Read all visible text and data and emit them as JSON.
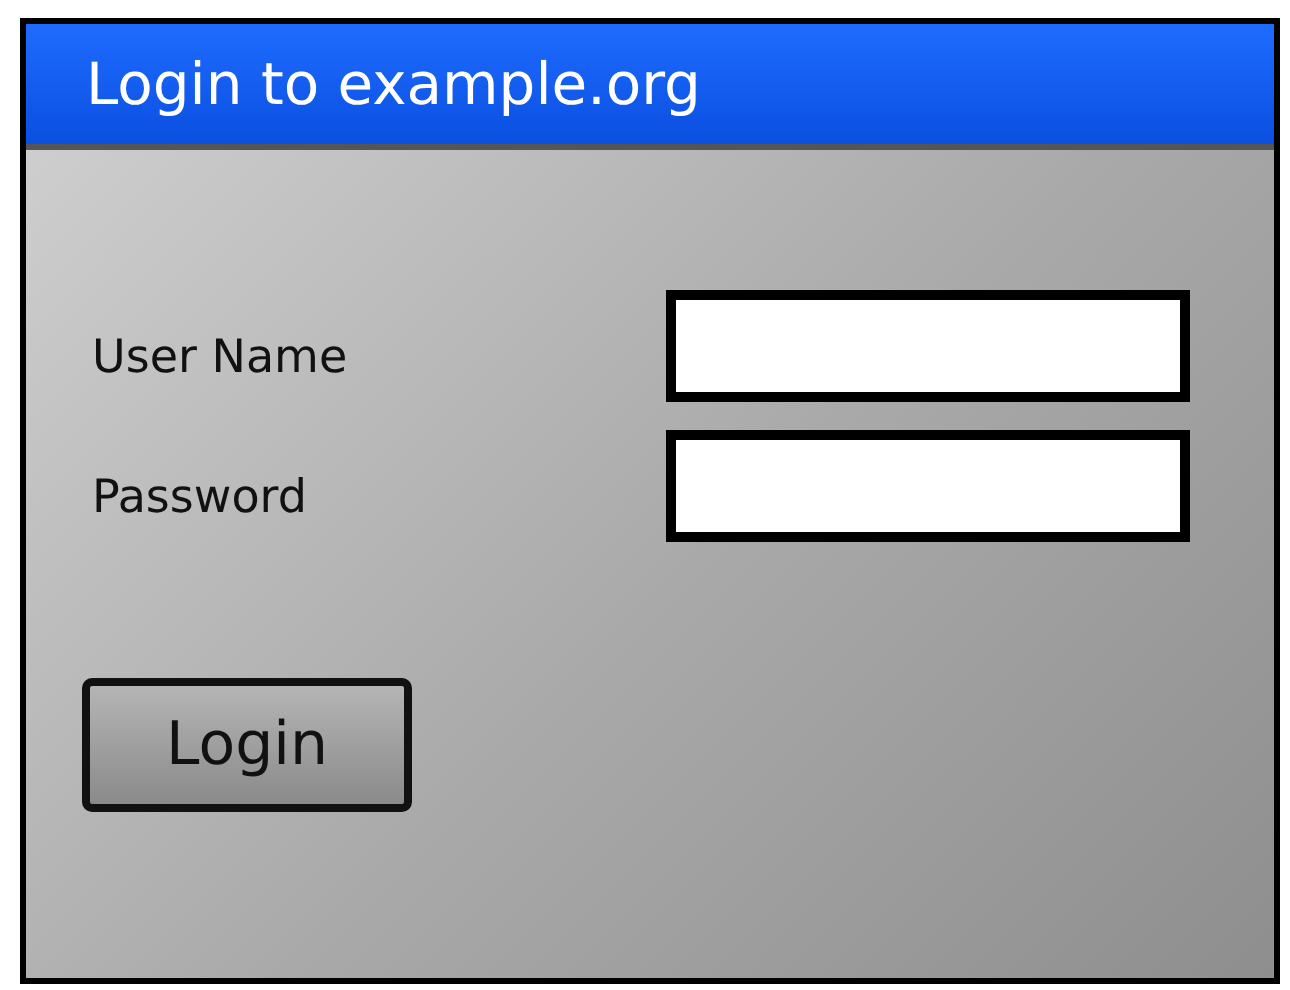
{
  "window": {
    "title": "Login to example.org"
  },
  "fields": [
    {
      "label": "User Name"
    },
    {
      "label": "Password"
    }
  ],
  "button": {
    "label": "Login"
  }
}
